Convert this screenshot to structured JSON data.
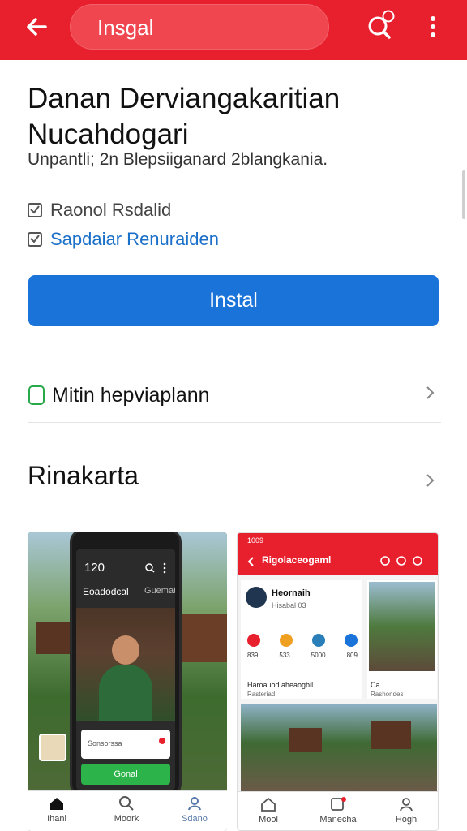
{
  "appbar": {
    "search_text": "Insgal",
    "accent": "#e8202e"
  },
  "app": {
    "title": "Danan Derviangakaritian Nucahdogari",
    "subtitle": "Unpantli; 2n Blepsiiganard 2blangkania.",
    "checks": [
      {
        "label": "Raonol Rsdalid"
      },
      {
        "label": "Sapdaiar Renuraiden"
      }
    ],
    "install_label": "Instal",
    "install_color": "#1a73d9"
  },
  "rows": {
    "permission_label": "Mitin hepviaplann"
  },
  "section": {
    "title": "Rinakarta"
  },
  "screenshot1": {
    "clock": "120",
    "header_left": "Eoadodcal",
    "header_right": "Guemat",
    "card_text": "Sonsorssa",
    "button": "Gonal",
    "nav": [
      "Ihanl",
      "Moork",
      "Sdano"
    ]
  },
  "screenshot2": {
    "status": "1009",
    "title": "Rigolaceogaml",
    "profile_name": "Heornaih",
    "profile_sub": "Hisabal 03",
    "stats": [
      "839",
      "533",
      "5000",
      "809"
    ],
    "caption": "Haroauod aheaogbil",
    "caption_right": "Ca",
    "sub_caption": "Rasteriad",
    "sub_caption_right": "Rashondes",
    "nav": [
      "Mool",
      "Manecha",
      "Hogh"
    ]
  }
}
